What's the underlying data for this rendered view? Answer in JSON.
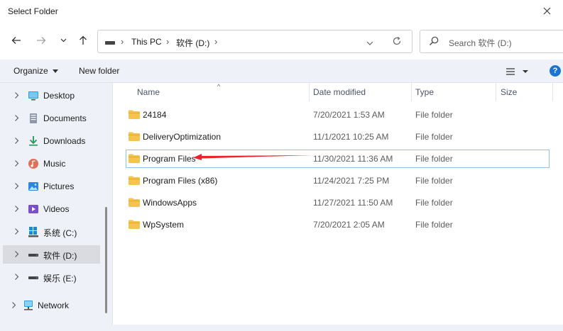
{
  "window": {
    "title": "Select Folder"
  },
  "address": {
    "crumbs": [
      "This PC",
      "软件 (D:)"
    ]
  },
  "search": {
    "placeholder": "Search 软件 (D:)"
  },
  "commandbar": {
    "organize_label": "Organize",
    "new_folder_label": "New folder",
    "help_label": "?"
  },
  "nav": {
    "items": [
      {
        "label": "Desktop",
        "icon": "desktop-icon"
      },
      {
        "label": "Documents",
        "icon": "documents-icon"
      },
      {
        "label": "Downloads",
        "icon": "downloads-icon"
      },
      {
        "label": "Music",
        "icon": "music-icon"
      },
      {
        "label": "Pictures",
        "icon": "pictures-icon"
      },
      {
        "label": "Videos",
        "icon": "videos-icon"
      },
      {
        "label": "系统 (C:)",
        "icon": "windows-drive-icon"
      },
      {
        "label": "软件 (D:)",
        "icon": "drive-icon",
        "selected": true
      },
      {
        "label": "娱乐 (E:)",
        "icon": "drive-icon"
      },
      {
        "label": "Network",
        "icon": "network-icon"
      }
    ]
  },
  "columns": {
    "name": "Name",
    "date": "Date modified",
    "type": "Type",
    "size": "Size"
  },
  "files": [
    {
      "name": "24184",
      "date": "7/20/2021 1:53 AM",
      "type": "File folder"
    },
    {
      "name": "DeliveryOptimization",
      "date": "11/1/2021 10:25 AM",
      "type": "File folder"
    },
    {
      "name": "Program Files",
      "date": "11/30/2021 11:36 AM",
      "type": "File folder",
      "selected": true
    },
    {
      "name": "Program Files (x86)",
      "date": "11/24/2021 7:25 PM",
      "type": "File folder"
    },
    {
      "name": "WindowsApps",
      "date": "11/27/2021 11:50 AM",
      "type": "File folder"
    },
    {
      "name": "WpSystem",
      "date": "7/20/2021 2:05 AM",
      "type": "File folder"
    }
  ],
  "colors": {
    "accent": "#1a73d1",
    "selection_border": "#8fc0ea",
    "folder": "#f5c34e",
    "annotation_arrow": "#e8262a",
    "pane_bg": "#eef1f7"
  }
}
